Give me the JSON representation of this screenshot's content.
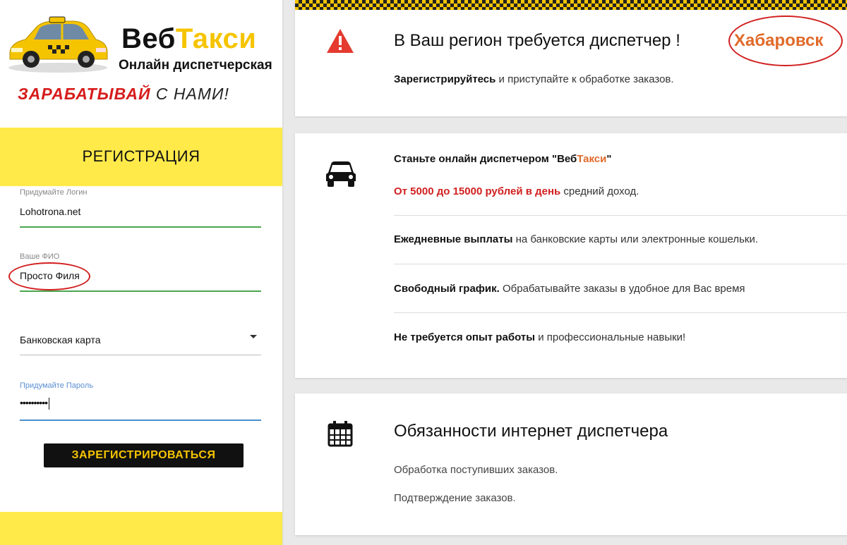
{
  "brand": {
    "name_part1": "Веб",
    "name_part2": "Такси",
    "subtitle": "Онлайн диспетчерская",
    "slogan_part1": "ЗАРАБАТЫВАЙ",
    "slogan_part2": " С НАМИ!"
  },
  "registration": {
    "title": "РЕГИСТРАЦИЯ",
    "login": {
      "label": "Придумайте Логин",
      "value": "Lohotrona.net"
    },
    "name": {
      "label": "Ваше ФИО",
      "value": "Просто Филя"
    },
    "payment": {
      "selected": "Банковская карта"
    },
    "password": {
      "label": "Придумайте Пароль",
      "value": "••••••••••"
    },
    "submit_label": "ЗАРЕГИСТРИРОВАТЬСЯ"
  },
  "card1": {
    "title": "В Ваш регион требуется диспетчер !",
    "city": "Хабаровск",
    "text_bold": "Зарегистрируйтесь",
    "text_rest": " и приступайте к обработке заказов."
  },
  "card2": {
    "intro_prefix": "Станьте онлайн диспетчером \"Веб",
    "intro_accent": "Такси",
    "intro_suffix": "\"",
    "income_red": "От 5000 до 15000 рублей в день",
    "income_rest": " средний доход.",
    "payout_bold": "Ежедневные выплаты",
    "payout_rest": " на банковские карты или электронные кошельки.",
    "schedule_bold": "Свободный график.",
    "schedule_rest": " Обрабатывайте заказы в удобное для Вас время",
    "experience_bold": "Не требуется опыт работы",
    "experience_rest": " и профессиональные навыки!"
  },
  "card3": {
    "title": "Обязанности интернет диспетчера",
    "item1": "Обработка поступивших заказов.",
    "item2": "Подтверждение заказов."
  },
  "colors": {
    "brand_yellow": "#f5c400",
    "panel_yellow": "#ffea4a",
    "accent_orange": "#e06a2a",
    "alert_red": "#d11f1f",
    "annotation_red": "#d11f1f"
  },
  "icons": [
    "taxi-car-logo",
    "warning-icon",
    "car-icon",
    "calendar-icon",
    "chevron-down-icon"
  ]
}
